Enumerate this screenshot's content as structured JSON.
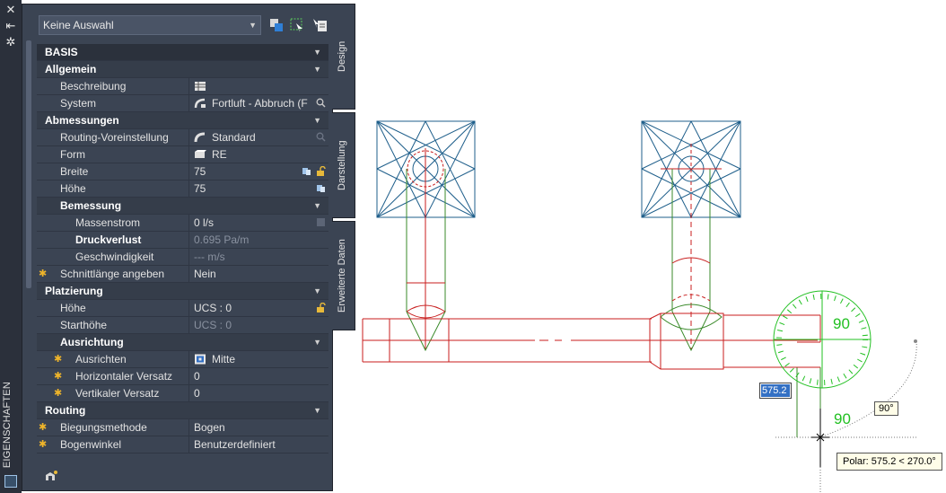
{
  "strip": {
    "title": "EIGENSCHAFTEN"
  },
  "selector": {
    "value": "Keine Auswahl"
  },
  "tabs": [
    "Design",
    "Darstellung",
    "Erweiterte Daten"
  ],
  "sections": {
    "basis": "BASIS",
    "allgemein": "Allgemein",
    "abmessungen": "Abmessungen",
    "bemessung": "Bemessung",
    "platzierung": "Platzierung",
    "ausrichtung": "Ausrichtung",
    "routing": "Routing"
  },
  "props": {
    "beschreibung": {
      "label": "Beschreibung",
      "value": ""
    },
    "system": {
      "label": "System",
      "value": "Fortluft - Abbruch (F"
    },
    "routing_voreinstellung": {
      "label": "Routing-Voreinstellung",
      "value": "Standard"
    },
    "form": {
      "label": "Form",
      "value": "RE"
    },
    "breite": {
      "label": "Breite",
      "value": "75"
    },
    "hoehe": {
      "label": "Höhe",
      "value": "75"
    },
    "massenstrom": {
      "label": "Massenstrom",
      "value": "0 l/s"
    },
    "druckverlust": {
      "label": "Druckverlust",
      "value": "0.695 Pa/m"
    },
    "geschwindigkeit": {
      "label": "Geschwindigkeit",
      "value": "--- m/s"
    },
    "schnittlaenge": {
      "label": "Schnittlänge angeben",
      "value": "Nein"
    },
    "pl_hoehe": {
      "label": "Höhe",
      "value": "UCS : 0"
    },
    "starthoehe": {
      "label": "Starthöhe",
      "value": "UCS : 0"
    },
    "ausrichten": {
      "label": "Ausrichten",
      "value": "Mitte"
    },
    "horizontaler_versatz": {
      "label": "Horizontaler Versatz",
      "value": "0"
    },
    "vertikaler_versatz": {
      "label": "Vertikaler Versatz",
      "value": "0"
    },
    "biegungsmethode": {
      "label": "Biegungsmethode",
      "value": "Bogen"
    },
    "bogenwinkel": {
      "label": "Bogenwinkel",
      "value": "Benutzerdefiniert"
    }
  },
  "drawing": {
    "dim_input": "575.2",
    "angle_label": "90°",
    "polar_tooltip": "Polar: 575.2 < 270.0°",
    "arc_label_top": "90",
    "arc_label_bottom": "90"
  },
  "colors": {
    "panel_bg": "#3b4453",
    "duct_red": "#c81e1e",
    "duct_green": "#3a8a2a",
    "diffuser_blue": "#1f5f8b",
    "compass_green": "#22c022",
    "highlight_blue": "#3370c4"
  }
}
